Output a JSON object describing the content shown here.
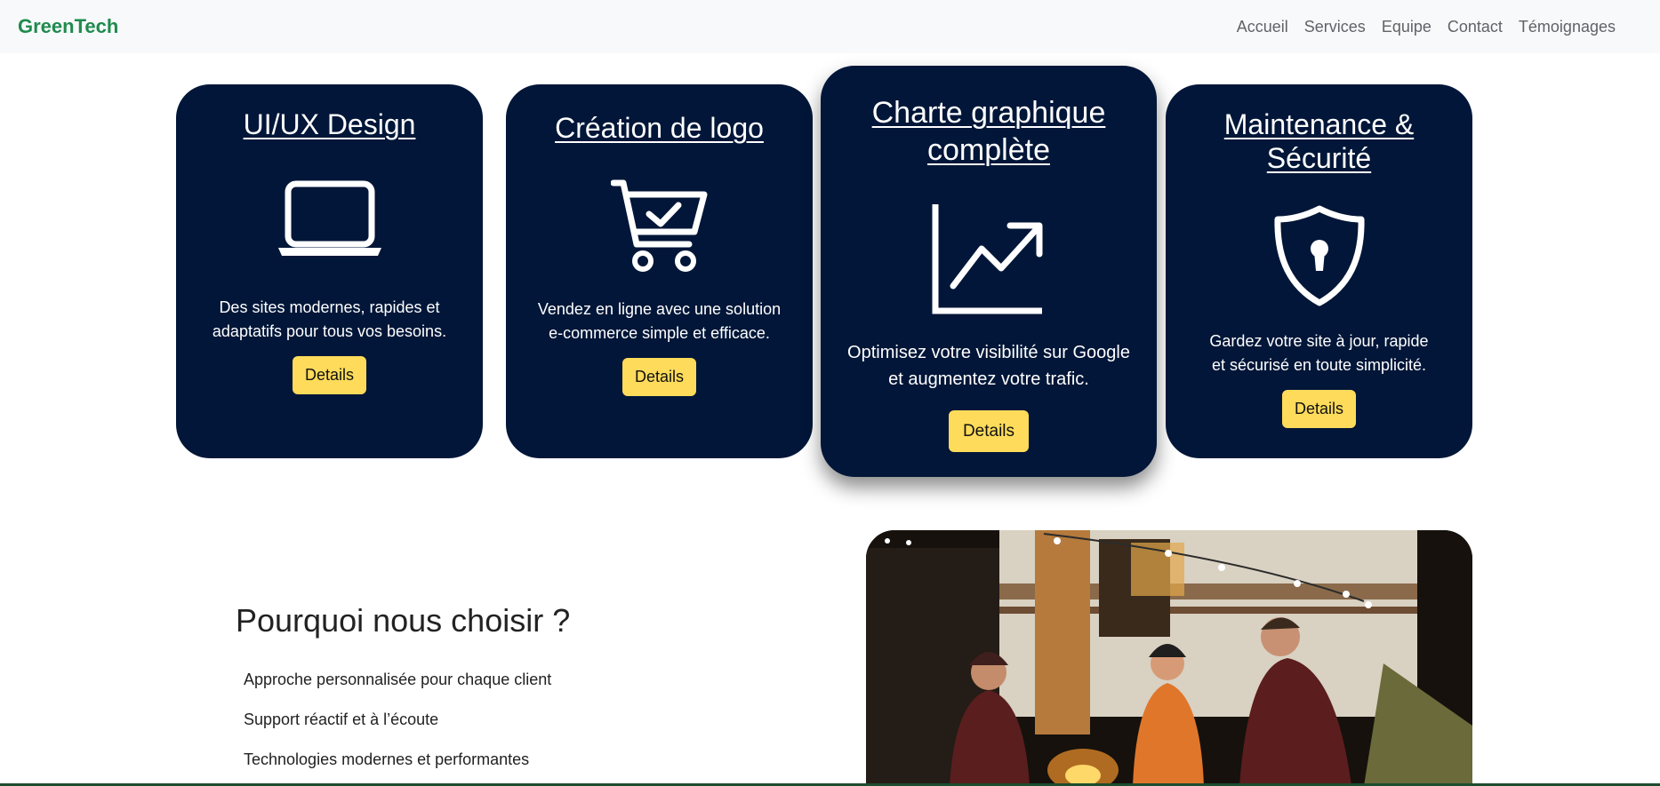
{
  "navbar": {
    "brand": "GreenTech",
    "links": [
      "Accueil",
      "Services",
      "Equipe",
      "Contact",
      "Témoignages"
    ]
  },
  "services": [
    {
      "title": "UI/UX Design",
      "icon": "laptop-icon",
      "description": "Des sites modernes, rapides et adaptatifs pour tous vos besoins.",
      "button": "Details"
    },
    {
      "title": "Création de logo",
      "icon": "shopping-cart-check-icon",
      "description": "Vendez en ligne avec une solution e-commerce simple et efficace.",
      "button": "Details"
    },
    {
      "title": "Charte graphique complète",
      "icon": "trending-chart-icon",
      "description": "Optimisez votre visibilité sur Google et augmentez votre trafic.",
      "button": "Details"
    },
    {
      "title": "Maintenance & Sécurité",
      "icon": "shield-lock-icon",
      "description": "Gardez votre site à jour, rapide et sécurisé en toute simplicité.",
      "button": "Details"
    }
  ],
  "why": {
    "title": "Pourquoi nous choisir ?",
    "items": [
      "Approche personnalisée pour chaque client",
      "Support réactif et à l’écoute",
      "Technologies modernes et performantes"
    ]
  },
  "colors": {
    "brand": "#1e8b4e",
    "card_bg": "#011638",
    "button_bg": "#fedb5a",
    "navbar_bg": "#f8f9fa"
  }
}
